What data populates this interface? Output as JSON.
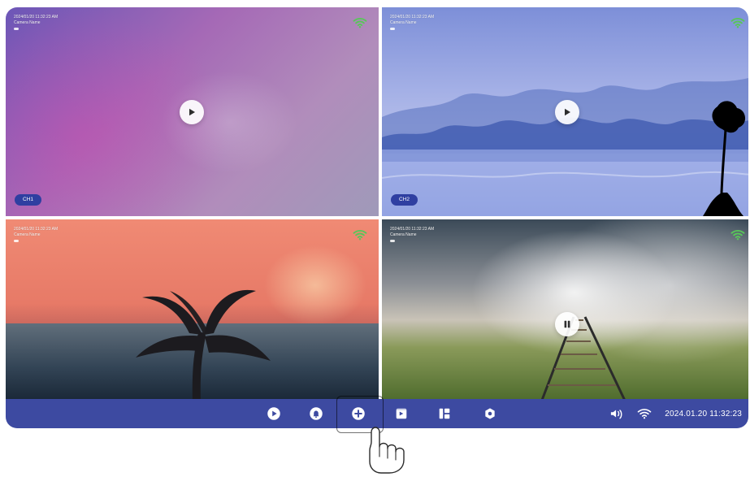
{
  "tiles": [
    {
      "id": "tile-1",
      "time": "2024/01/20 11:32:23 AM",
      "camera_name": "Camera Name",
      "channel": "CH1",
      "playback_state": "play"
    },
    {
      "id": "tile-2",
      "time": "2024/01/20 11:32:23 AM",
      "camera_name": "Camera Name",
      "channel": "CH2",
      "playback_state": "play"
    },
    {
      "id": "tile-3",
      "time": "2024/01/20 11:32:23 AM",
      "camera_name": "Camera Name",
      "channel": "",
      "playback_state": "none"
    },
    {
      "id": "tile-4",
      "time": "2024/01/20 11:32:23 AM",
      "camera_name": "Camera Name",
      "channel": "",
      "playback_state": "pause"
    }
  ],
  "bottom_bar": {
    "icons": [
      {
        "name": "play-circle-icon"
      },
      {
        "name": "alarm-icon"
      },
      {
        "name": "add-circle-icon"
      },
      {
        "name": "video-playback-icon"
      },
      {
        "name": "layout-icon"
      },
      {
        "name": "settings-icon"
      }
    ],
    "status": {
      "volume_icon": "volume-icon",
      "wifi_icon": "wifi-icon",
      "datetime": "2024.01.20  11:32:23"
    }
  },
  "colors": {
    "bar_blue": "#3d4aa1",
    "wifi_green": "#59c65a",
    "badge_blue": "#2f3fa1"
  }
}
